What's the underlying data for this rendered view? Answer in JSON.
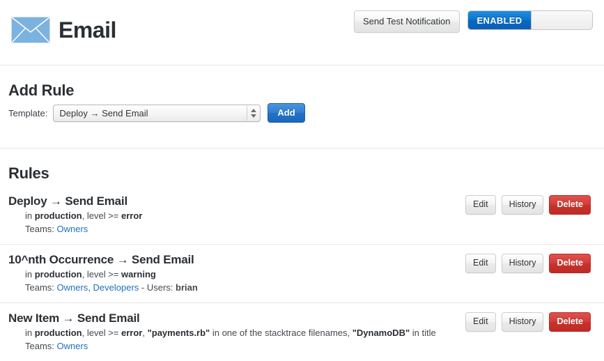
{
  "header": {
    "icon": "envelope-icon",
    "title": "Email",
    "send_test_label": "Send Test Notification",
    "toggle": {
      "on_label": "ENABLED",
      "off_label": "",
      "state": "enabled",
      "on_color": "#0c72cc"
    }
  },
  "add_rule": {
    "title": "Add Rule",
    "template_label": "Template:",
    "template_value": "Deploy → Send Email",
    "add_label": "Add",
    "stepper_up_icon": "arrow-up-icon",
    "stepper_down_icon": "arrow-down-icon"
  },
  "rules_section": {
    "title": "Rules",
    "actions": {
      "edit_label": "Edit",
      "history_label": "History",
      "delete_label": "Delete"
    },
    "rules": [
      {
        "name": "Deploy → Send Email",
        "detail_html": "in <b>production</b>, level &gt;= <b>error</b>",
        "teams_html": "Teams: <span class=\"lnk\">Owners</span>"
      },
      {
        "name": "10^nth Occurrence → Send Email",
        "detail_html": "in <b>production</b>, level &gt;= <b>warning</b>",
        "teams_html": "Teams: <span class=\"lnk\">Owners</span>, <span class=\"lnk\">Developers</span> - Users: <b>brian</b>"
      },
      {
        "name": "New Item → Send Email",
        "detail_html": "in <b>production</b>, level &gt;= <b>error</b>, <b>\"payments.rb\"</b> in one of the stacktrace filenames, <b>\"DynamoDB\"</b> in title",
        "teams_html": "Teams: <span class=\"lnk\">Owners</span>"
      }
    ]
  },
  "colors": {
    "link": "#1f70c1",
    "danger": "#c9322c",
    "primary": "#2273c8",
    "envelope": "#7cb2e0",
    "divider": "#e7e7e7"
  }
}
